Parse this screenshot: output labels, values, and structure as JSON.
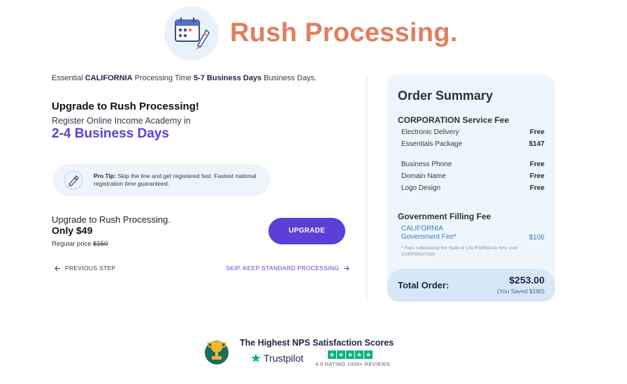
{
  "header": {
    "title": "Rush Processing."
  },
  "left": {
    "essential": {
      "prefix": "Essential ",
      "state": "CALIFORNIA",
      "middle": " Processing Time ",
      "days": "5-7 Business Days",
      "suffix": " Business Days."
    },
    "upgrade_heading": "Upgrade to Rush Processing!",
    "register_line": "Register Online Income Academy in",
    "rush_days": "2-4 Business Days",
    "protip": {
      "label": "Pro Tip:",
      "text": " Skip the line and get registered fast. Fastest national registration time guaranteed."
    },
    "upsell_line": "Upgrade to Rush Processing.",
    "only_price": "Only $49",
    "regular_label": "Regular price ",
    "regular_price": "$150",
    "upgrade_button": "UPGRADE",
    "previous_step": "PREVIOUS STEP",
    "skip_link": "SKIP, KEEP STANDARD PROCESSING"
  },
  "summary": {
    "title": "Order Summary",
    "service_title": "CORPORATION Service Fee",
    "service_rows": [
      {
        "label": "Electronic Delivery",
        "value": "Free"
      },
      {
        "label": "Essentials Package",
        "value": "$147"
      },
      {
        "label": "Business Phone",
        "value": "Free"
      },
      {
        "label": "Domain Name",
        "value": "Free"
      },
      {
        "label": "Logo Design",
        "value": "Free"
      }
    ],
    "gov_title": "Government Filling Fee",
    "gov_line1": "CALIFORNIA",
    "gov_line2": "Government Fee*",
    "gov_value": "$106",
    "footnote": "* Fees collected by the State of CALIFORNIA to form your CORPORATION",
    "total_label": "Total Order:",
    "total_amount": "$253.00",
    "saved": "(You Saved $180)"
  },
  "footer": {
    "nps_title": "The Highest NPS Satisfaction Scores",
    "trustpilot": "Trustpilot",
    "rating": "4.9 RATING  1000+ REVIEWS"
  },
  "icons": {
    "hero": "calendar-rocket-icon",
    "protip": "rocket-icon",
    "trophy": "trophy-icon",
    "trustpilot_star": "star-icon"
  },
  "colors": {
    "title": "#e07f5e",
    "accent": "#5b3fd6",
    "summary_bg": "#eef5fc",
    "trustpilot_green": "#00b67a"
  }
}
